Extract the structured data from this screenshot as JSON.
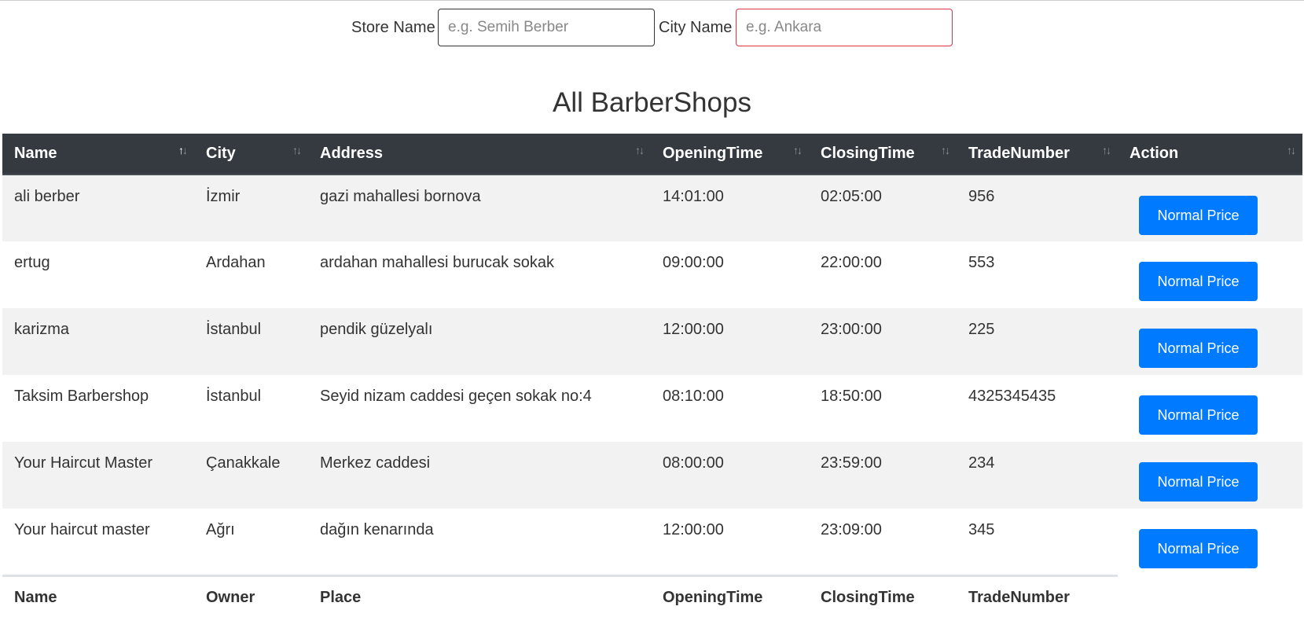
{
  "search": {
    "store_label": "Store Name",
    "store_placeholder": "e.g. Semih Berber",
    "city_label": "City Name",
    "city_placeholder": "e.g. Ankara"
  },
  "page_title": "All BarberShops",
  "table": {
    "headers": [
      "Name",
      "City",
      "Address",
      "OpeningTime",
      "ClosingTime",
      "TradeNumber",
      "Action"
    ],
    "rows": [
      {
        "name": "ali berber",
        "city": "İzmir",
        "address": "gazi mahallesi bornova",
        "opening": "14:01:00",
        "closing": "02:05:00",
        "trade": "956",
        "action": "Normal Price"
      },
      {
        "name": "ertug",
        "city": "Ardahan",
        "address": "ardahan mahallesi burucak sokak",
        "opening": "09:00:00",
        "closing": "22:00:00",
        "trade": "553",
        "action": "Normal Price"
      },
      {
        "name": "karizma",
        "city": "İstanbul",
        "address": "pendik güzelyalı",
        "opening": "12:00:00",
        "closing": "23:00:00",
        "trade": "225",
        "action": "Normal Price"
      },
      {
        "name": "Taksim Barbershop",
        "city": "İstanbul",
        "address": "Seyid nizam caddesi geçen sokak no:4",
        "opening": "08:10:00",
        "closing": "18:50:00",
        "trade": "4325345435",
        "action": "Normal Price"
      },
      {
        "name": "Your Haircut Master",
        "city": "Çanakkale",
        "address": "Merkez caddesi",
        "opening": "08:00:00",
        "closing": "23:59:00",
        "trade": "234",
        "action": "Normal Price"
      },
      {
        "name": "Your haircut master",
        "city": "Ağrı",
        "address": "dağın kenarında",
        "opening": "12:00:00",
        "closing": "23:09:00",
        "trade": "345",
        "action": "Normal Price"
      }
    ],
    "footer": [
      "Name",
      "Owner",
      "Place",
      "OpeningTime",
      "ClosingTime",
      "TradeNumber"
    ]
  },
  "icons": {
    "sort": "sort-arrows-icon",
    "sort_active_column": "Name"
  },
  "colors": {
    "header_bg": "#343a40",
    "button_bg": "#007bff",
    "invalid_border": "#dc3545",
    "stripe": "#f2f2f2"
  }
}
